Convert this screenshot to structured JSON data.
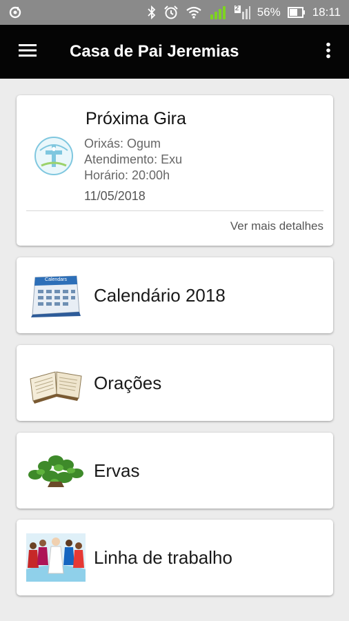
{
  "status_bar": {
    "battery": "56%",
    "time": "18:11",
    "sim_badge": "2"
  },
  "app_bar": {
    "title": "Casa de Pai Jeremias"
  },
  "next_gira": {
    "title": "Próxima Gira",
    "orixas": "Orixás: Ogum",
    "atendimento": "Atendimento: Exu",
    "horario": "Horário: 20:00h",
    "date": "11/05/2018",
    "details_link": "Ver mais detalhes"
  },
  "menu": {
    "items": [
      {
        "label": "Calendário 2018",
        "icon": "calendar-icon"
      },
      {
        "label": "Orações",
        "icon": "book-icon"
      },
      {
        "label": "Ervas",
        "icon": "herbs-icon"
      },
      {
        "label": "Linha de trabalho",
        "icon": "figures-icon"
      }
    ]
  },
  "calendar_badge": "Calendars",
  "colors": {
    "app_bar": "#050505",
    "status_bar": "#8a8a8a",
    "background": "#ececec",
    "signal_green": "#7ed321"
  }
}
